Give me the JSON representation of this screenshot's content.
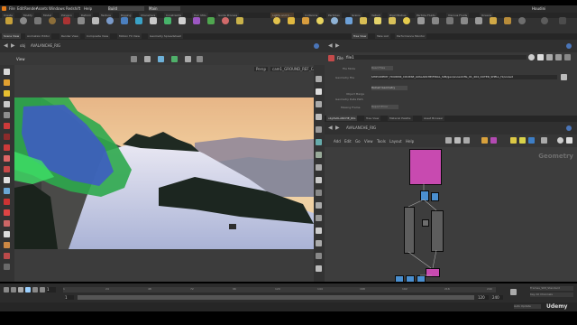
{
  "app": {
    "title": "Houdini"
  },
  "menu": [
    "File",
    "Edit",
    "Render",
    "Assets",
    "Windows",
    "Redshift",
    "Help"
  ],
  "desktop": "Build",
  "main_dropdown": "Main",
  "shelf_tabs_left": [
    "Create",
    "Modify",
    "Model",
    "Polygon",
    "Deform",
    "Texture",
    "Rigging",
    "Characters",
    "Constraints",
    "Hair Utils",
    "Guide Process"
  ],
  "shelf_tabs_right": [
    "Lights and C...",
    "Collisions",
    "Particles",
    "Grains",
    "Vellum",
    "Rigid Bodies",
    "Particle Fluids",
    "Viscous Fluids",
    "Oceans"
  ],
  "left_panel_tabs": [
    "Scene View",
    "Animation Editor",
    "Render View",
    "Composite View",
    "Motion FX View",
    "Geometry Spreadsheet"
  ],
  "viewport": {
    "path_obj": "obj",
    "path_node": "AVALANCHE_RIG",
    "label": "View",
    "camera": "Persp",
    "camera2": "cam1_GROUND_REF_CAM",
    "watermark": "Geometry"
  },
  "param_panel": {
    "tabs": [
      "Tree View",
      "Take List",
      "Performance Monitor"
    ],
    "node_type": "File",
    "node_name": "file1",
    "rows": [
      {
        "label": "File Mode",
        "value": "Read Files"
      },
      {
        "label": "Geometry File",
        "value": "$HIP/UDEMY_HOUDINI_COURSE_AVALANCHE/FINAL_SIM/geo/snowdrifts_01_404_OUTER_SHELL_f1/snowd"
      },
      {
        "label": "Object Merge",
        "value": ""
      },
      {
        "label": "Geometry Data Path",
        "value": ""
      },
      {
        "label": "Reload Geometry",
        "value": ""
      },
      {
        "label": "Missing Frame",
        "value": "Report Error"
      }
    ]
  },
  "network": {
    "tabs": [
      "obj/AVALANCHE_RIG",
      "Tree View",
      "Material Palette",
      "Asset Browser"
    ],
    "path": "AVALANCHE_RIG",
    "menu": [
      "Add",
      "Edit",
      "Go",
      "View",
      "Tools",
      "Layout",
      "Help"
    ],
    "context_label": "Geometry"
  },
  "timeline": {
    "frame": "1",
    "start": "1",
    "end": "120",
    "range_end": "240",
    "ticks": [
      "1",
      "24",
      "48",
      "72",
      "96",
      "120",
      "144",
      "168",
      "192",
      "216",
      "240"
    ],
    "status_right": [
      "Frames_SIM_Standard",
      "Key All Channels"
    ],
    "auto_update": "Auto Update"
  },
  "watermark_brand": "Udemy",
  "colors": {
    "accent_purple": "#c84ab0",
    "node_blue": "#4a8fcf",
    "sky": "#f0c89a",
    "snow": "#d9d6ee",
    "glow_green": "#42e05a"
  }
}
